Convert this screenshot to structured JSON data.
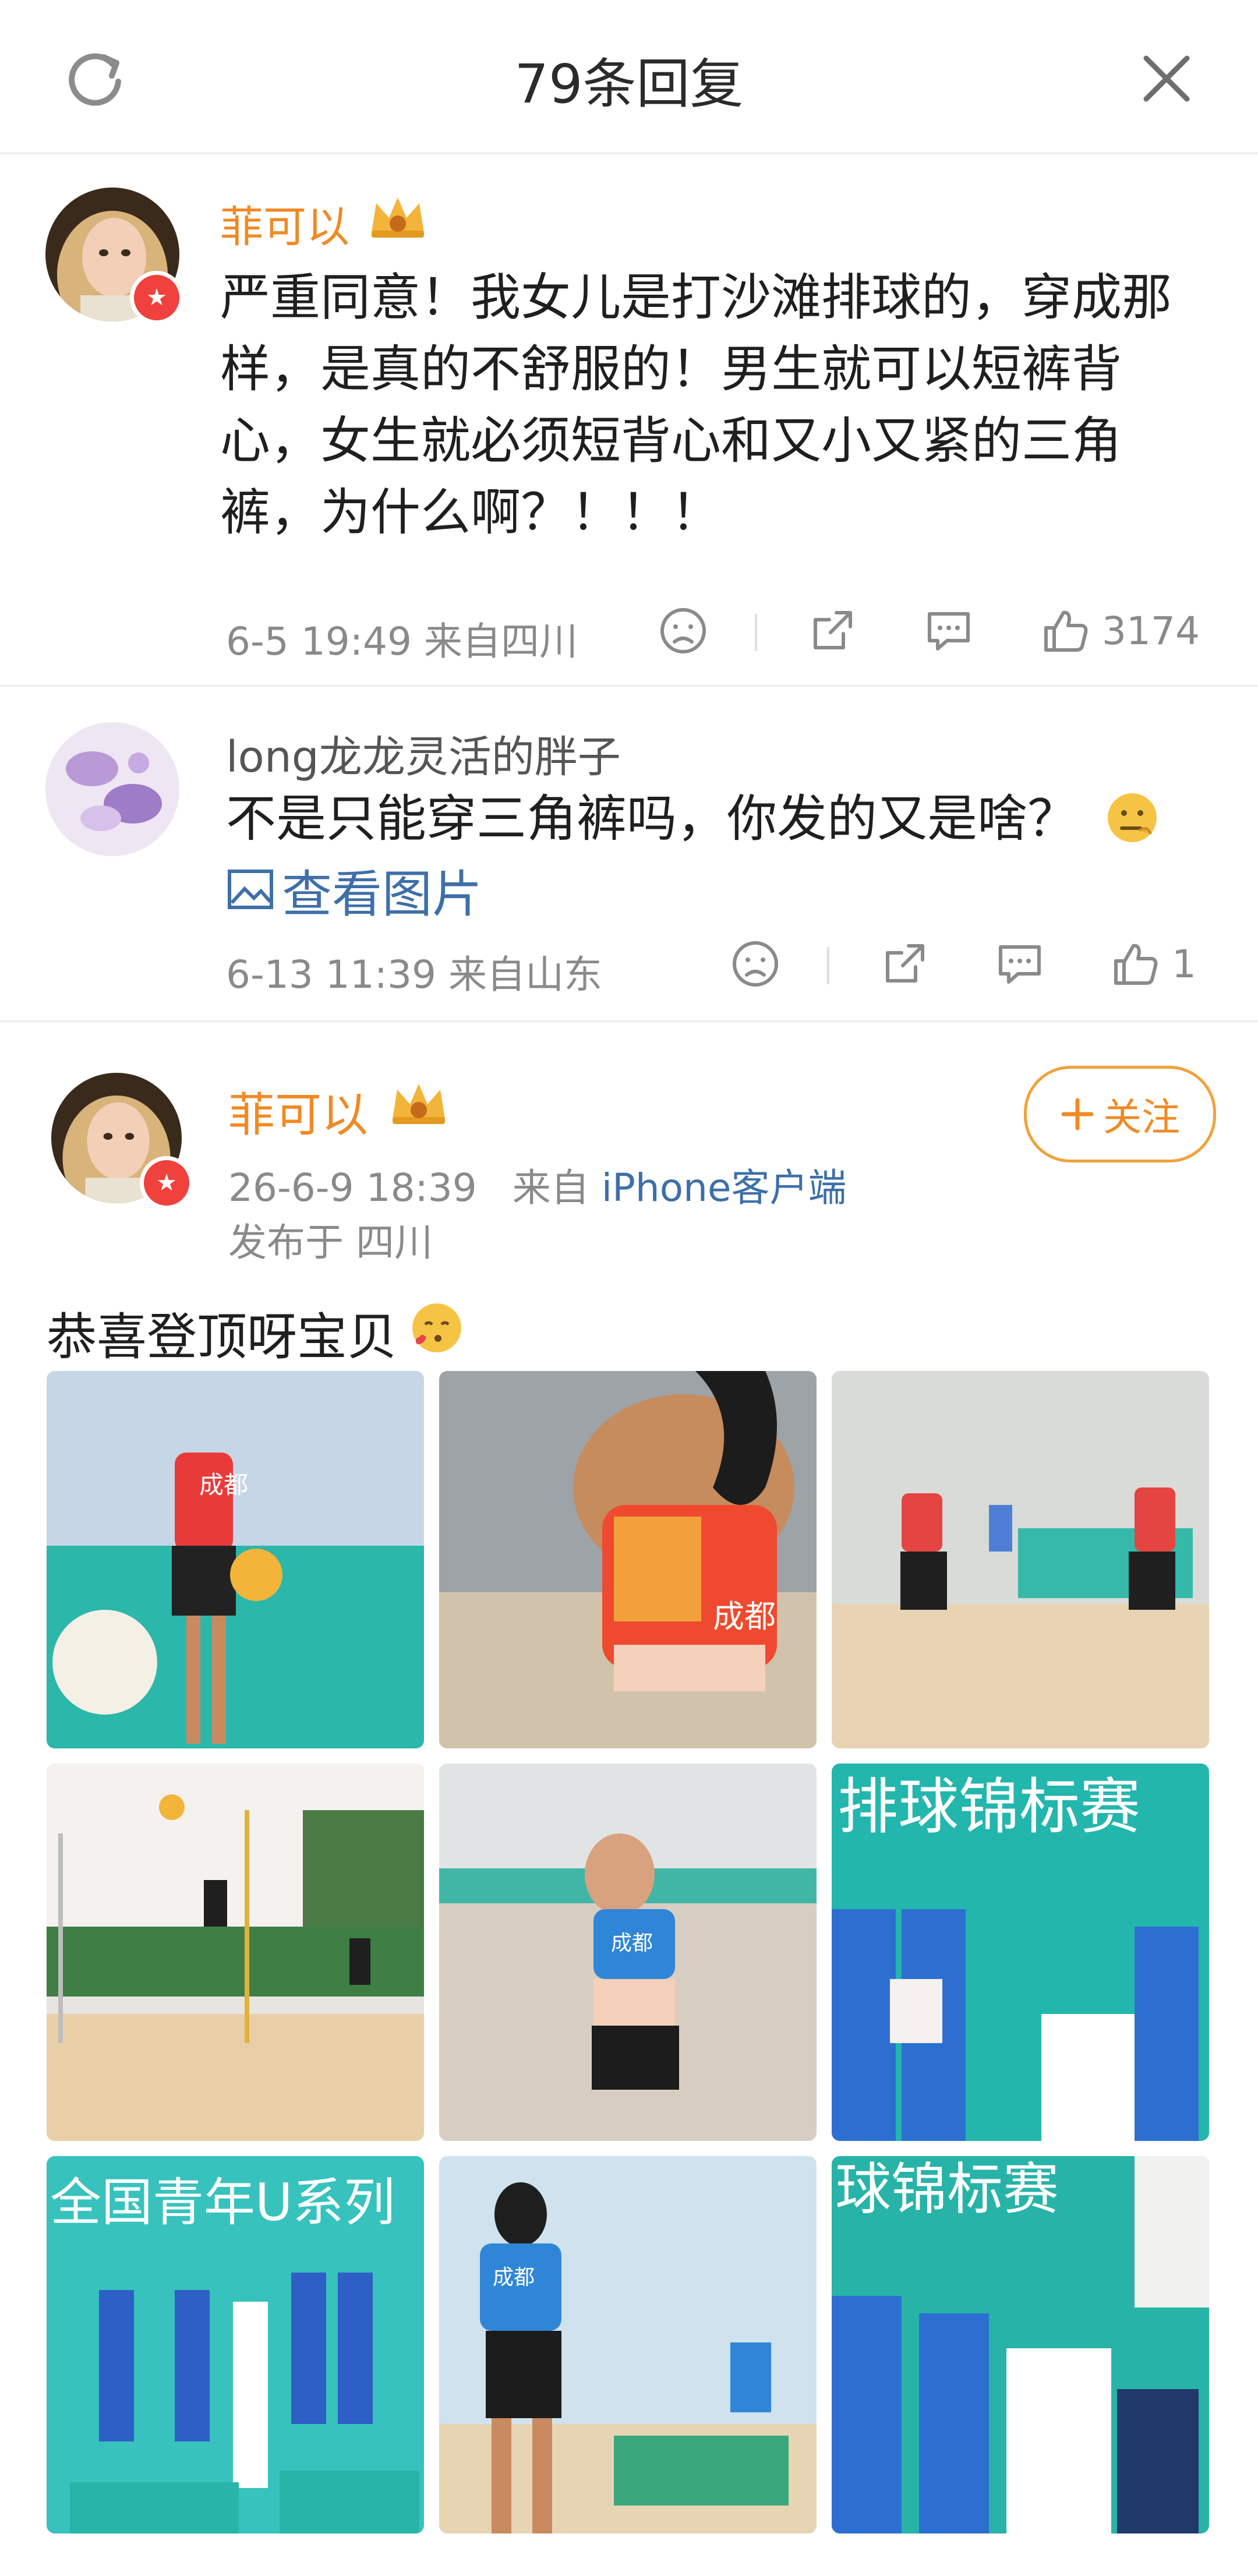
{
  "header": {
    "title": "79条回复",
    "refresh_icon": "refresh-icon",
    "close_icon": "close-icon"
  },
  "comments": [
    {
      "username": "菲可以",
      "text": "严重同意！我女儿是打沙滩排球的，穿成那样，是真的不舒服的！男生就可以短裤背心，女生就必须短背心和又小又紧的三角裤，为什么啊？！！！",
      "time_location": "6-5 19:49  来自四川",
      "likes": "3174"
    },
    {
      "username": "long龙龙灵活的胖子",
      "text": "不是只能穿三角裤吗，你发的又是啥？",
      "view_image": "查看图片",
      "time_location": "6-13 11:39  来自山东",
      "likes": "1"
    }
  ],
  "post": {
    "username": "菲可以",
    "follow_label": "关注",
    "date": "26-6-9 18:39",
    "from_prefix": "来自",
    "client": "iPhone客户端",
    "published_in": "发布于 四川",
    "text": "恭喜登顶呀宝贝",
    "photos": [
      {
        "label": "成都"
      },
      {
        "label": "成都"
      },
      {
        "label": ""
      },
      {
        "label": ""
      },
      {
        "label": "成都"
      },
      {
        "label": "排球锦标赛"
      },
      {
        "label": "全国青年U系列"
      },
      {
        "label": "成都"
      },
      {
        "label": "球锦标赛"
      }
    ]
  },
  "colors": {
    "orange": "#f08a24",
    "link_blue": "#3e6fa8",
    "gray_text": "#8a8a8a"
  }
}
